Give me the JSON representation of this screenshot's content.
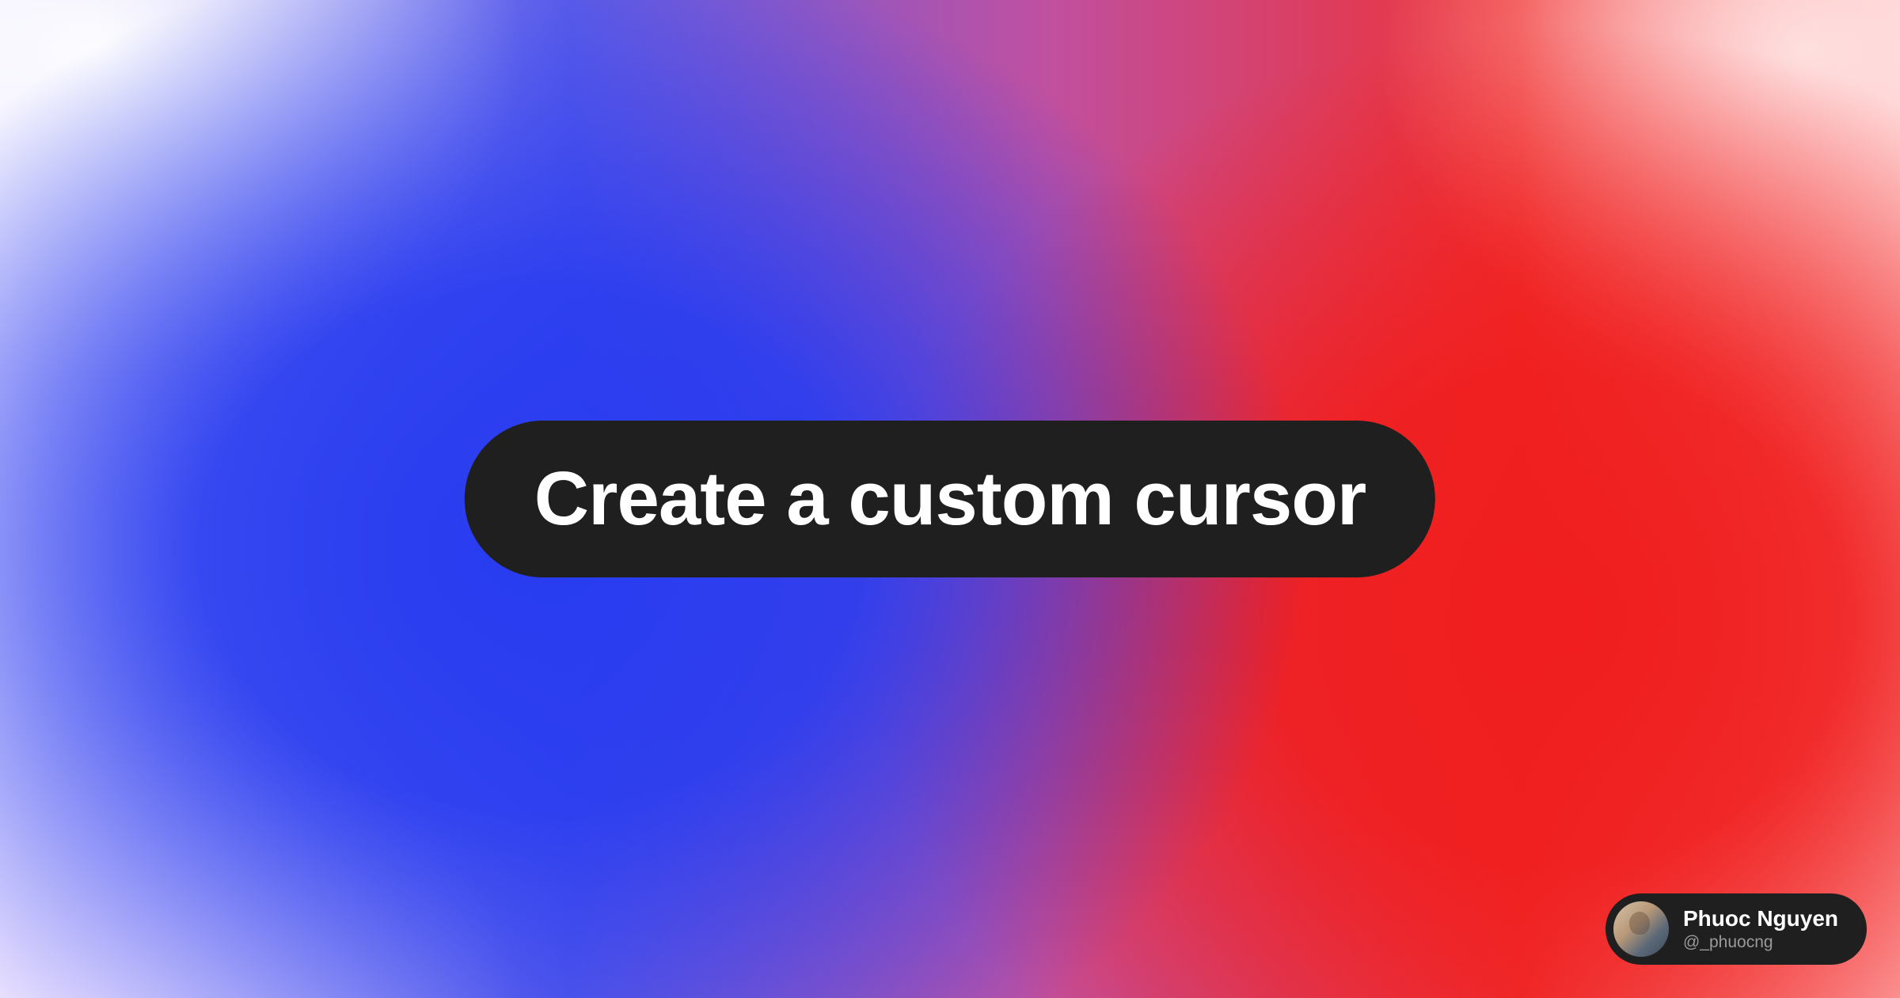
{
  "title": "Create a custom cursor",
  "author": {
    "name": "Phuoc Nguyen",
    "handle": "@_phuocng"
  },
  "colors": {
    "pill_bg": "#1f1f1f",
    "pill_text": "#ffffff",
    "gradient_blue": "#283cf0",
    "gradient_red": "#f01e1e"
  }
}
